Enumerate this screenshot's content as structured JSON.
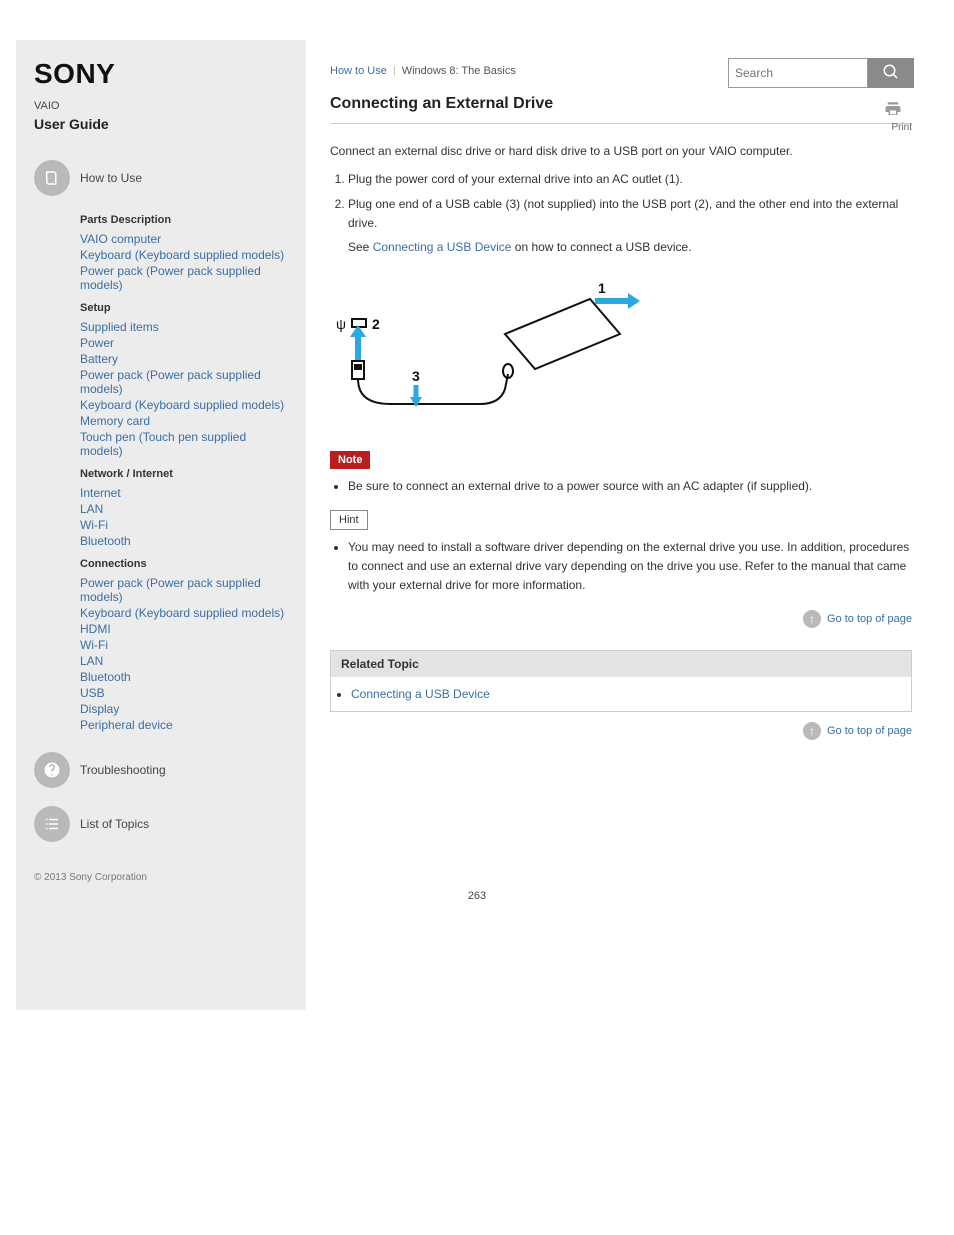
{
  "brand": "SONY",
  "product": {
    "label": "VAIO",
    "model": "User Guide"
  },
  "search": {
    "placeholder": "Search"
  },
  "sidebar": {
    "top_link": "How to Use",
    "sections": [
      {
        "heading": "Parts Description",
        "items": [
          "VAIO computer",
          "Keyboard (Keyboard supplied models)",
          "Power pack (Power pack supplied models)"
        ]
      },
      {
        "heading": "Setup",
        "items": [
          "Supplied items",
          "Power",
          "Battery",
          "Power pack (Power pack supplied models)",
          "Keyboard (Keyboard supplied models)",
          "Memory card",
          "Touch pen (Touch pen supplied models)"
        ]
      },
      {
        "heading": "Network / Internet",
        "items": [
          "Internet",
          "LAN",
          "Wi-Fi",
          "Bluetooth"
        ]
      },
      {
        "heading": "Connections",
        "items": [
          "Power pack (Power pack supplied models)",
          "Keyboard (Keyboard supplied models)",
          "HDMI",
          "Wi-Fi",
          "LAN",
          "Bluetooth",
          "USB",
          "Display",
          "Peripheral device"
        ]
      }
    ],
    "bottom": {
      "troubleshooting": "Troubleshooting",
      "list_heading": "List of Topics",
      "legal": "© 2013 Sony Corporation"
    }
  },
  "topbar": {
    "tab": "How to Use",
    "title": "Windows 8: The Basics"
  },
  "print_label": "Print",
  "title": "Connecting an External Drive",
  "intro": "Connect an external disc drive or hard disk drive to a USB port on your VAIO computer.",
  "steps": [
    "Plug the power cord of your external drive into an AC outlet (1).",
    "Plug one end of a USB cable (3) (not supplied) into the USB port (2), and the other end into the external drive."
  ],
  "see": "See",
  "see_link": "Connecting a USB Device",
  "see_tail": " on how to connect a USB device.",
  "note": {
    "label": "Note",
    "items": [
      "Be sure to connect an external drive to a power source with an AC adapter (if supplied)."
    ]
  },
  "hint": {
    "label": "Hint",
    "items": [
      "You may need to install a software driver depending on the external drive you use. In addition, procedures to connect and use an external drive vary depending on the drive you use. Refer to the manual that came with your external drive for more information."
    ]
  },
  "goto": "Go to top of page",
  "related": {
    "heading": "Related Topic",
    "items": [
      "Connecting a USB Device"
    ]
  },
  "page_number": "263",
  "legal": "© 2013 Sony Corporation"
}
